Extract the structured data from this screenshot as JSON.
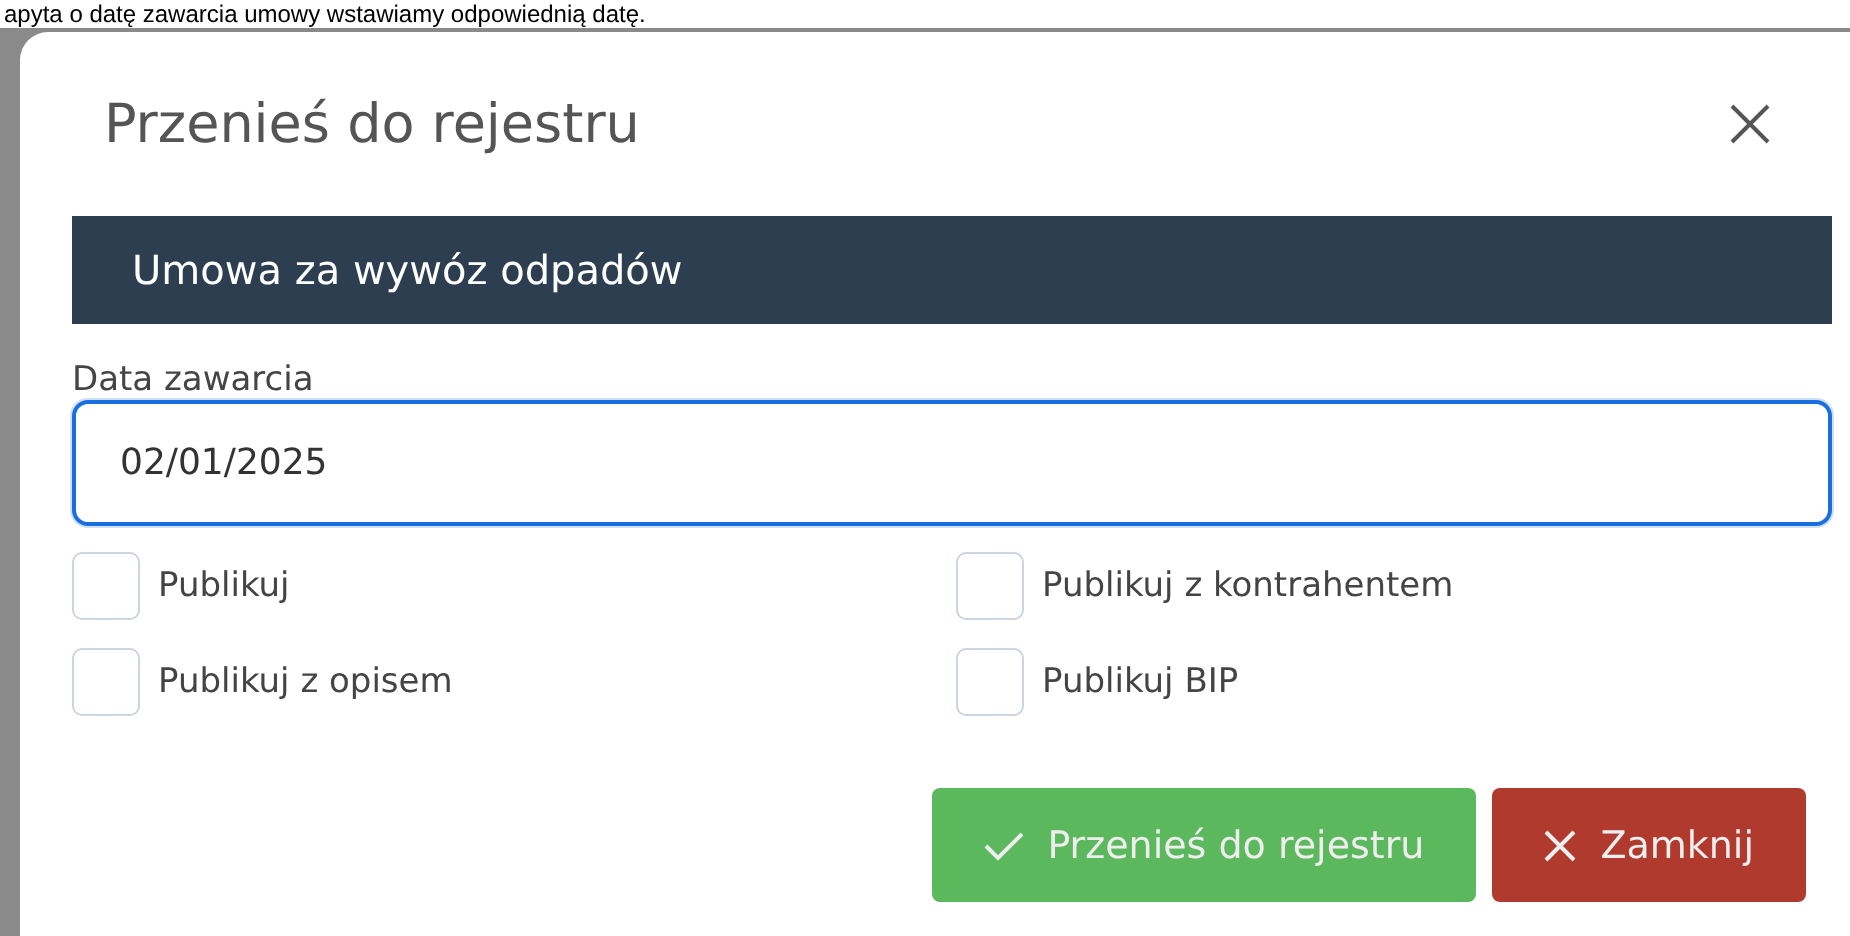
{
  "background_text": "apyta o datę zawarcia umowy wstawiamy odpowiednią datę.",
  "dialog": {
    "title": "Przenieś do rejestru",
    "section_header": "Umowa za wywóz odpadów",
    "date_field": {
      "label": "Data zawarcia",
      "value": "02/01/2025"
    },
    "checkboxes": [
      {
        "label": "Publikuj",
        "checked": false
      },
      {
        "label": "Publikuj z kontrahentem",
        "checked": false
      },
      {
        "label": "Publikuj z opisem",
        "checked": false
      },
      {
        "label": "Publikuj BIP",
        "checked": false
      }
    ],
    "buttons": [
      {
        "kind": "confirm",
        "label": "Przenieś do rejestru"
      },
      {
        "kind": "close",
        "label": "Zamknij"
      }
    ]
  }
}
